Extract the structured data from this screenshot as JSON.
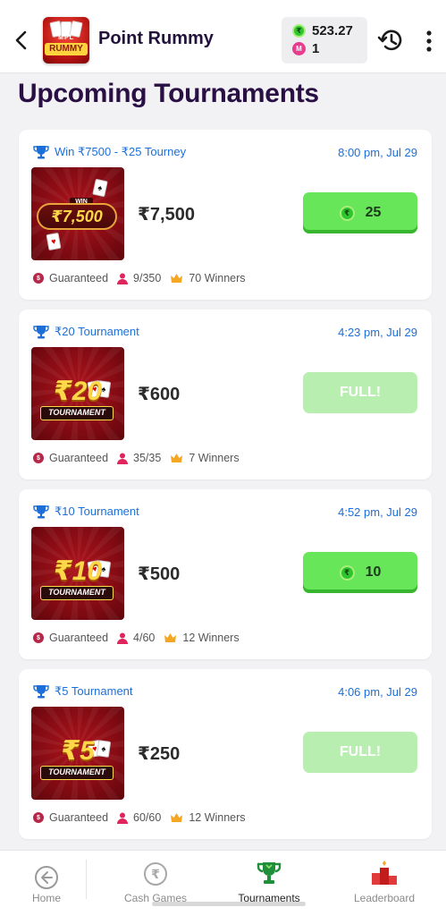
{
  "topbar": {
    "title": "Point Rummy",
    "logo_text_top": "MPL",
    "logo_text_main": "RUMMY",
    "wallet_cash": "523.27",
    "wallet_token": "1",
    "cash_icon": "rupee-coin-icon",
    "token_icon": "mpl-token-icon"
  },
  "page": {
    "heading": "Upcoming Tournaments"
  },
  "tournaments": [
    {
      "name": "Win ₹7500 - ₹25 Tourney",
      "time": "8:00 pm, Jul 29",
      "thumb_win": "WIN",
      "thumb_amount": "₹7,500",
      "prize": "₹7,500",
      "entry": "25",
      "full": false,
      "guaranteed": "Guaranteed",
      "players": "9/350",
      "winners": "70 Winners"
    },
    {
      "name": "₹20 Tournament",
      "time": "4:23 pm, Jul 29",
      "thumb_amount": "₹20",
      "thumb_banner": "TOURNAMENT",
      "prize": "₹600",
      "entry": "FULL!",
      "full": true,
      "guaranteed": "Guaranteed",
      "players": "35/35",
      "winners": "7 Winners"
    },
    {
      "name": "₹10 Tournament",
      "time": "4:52 pm, Jul 29",
      "thumb_amount": "₹10",
      "thumb_banner": "TOURNAMENT",
      "prize": "₹500",
      "entry": "10",
      "full": false,
      "guaranteed": "Guaranteed",
      "players": "4/60",
      "winners": "12 Winners"
    },
    {
      "name": "₹5 Tournament",
      "time": "4:06 pm, Jul 29",
      "thumb_amount": "₹5",
      "thumb_banner": "TOURNAMENT",
      "prize": "₹250",
      "entry": "FULL!",
      "full": true,
      "guaranteed": "Guaranteed",
      "players": "60/60",
      "winners": "12 Winners"
    }
  ],
  "bottom_nav": [
    {
      "label": "Home",
      "icon": "home-back-icon"
    },
    {
      "label": "Cash Games",
      "icon": "rupee-icon"
    },
    {
      "label": "Tournaments",
      "icon": "trophy-icon",
      "active": true
    },
    {
      "label": "Leaderboard",
      "icon": "podium-icon"
    }
  ],
  "colors": {
    "accent_blue": "#1c6fd8",
    "join_green": "#67e65a",
    "full_green": "#b8efb0",
    "heading_purple": "#2a0f45"
  }
}
